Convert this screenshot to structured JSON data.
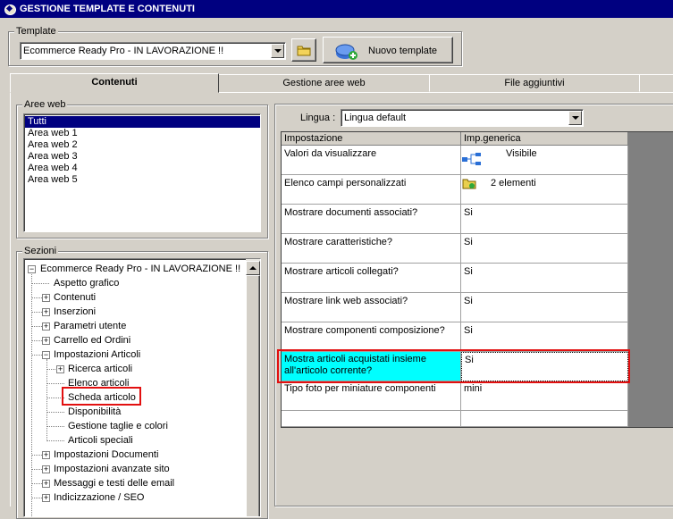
{
  "window": {
    "title": "GESTIONE TEMPLATE E CONTENUTI"
  },
  "template": {
    "group_label": "Template",
    "selected": "Ecommerce Ready Pro - IN LAVORAZIONE !!",
    "new_button": "Nuovo template"
  },
  "tabs": [
    "Contenuti",
    "Gestione aree web",
    "File aggiuntivi"
  ],
  "aree_web": {
    "label": "Aree web",
    "items": [
      "Tutti",
      "Area web 1",
      "Area web 2",
      "Area web 3",
      "Area web 4",
      "Area web 5"
    ]
  },
  "sezioni": {
    "label": "Sezioni",
    "tree": [
      "Ecommerce Ready Pro - IN LAVORAZIONE !!",
      "Aspetto grafico",
      "Contenuti",
      "Inserzioni",
      "Parametri utente",
      "Carrello ed Ordini",
      "Impostazioni Articoli",
      "Ricerca articoli",
      "Elenco articoli",
      "Scheda articolo",
      "Disponibilità",
      "Gestione taglie e colori",
      "Articoli speciali",
      "Impostazioni Documenti",
      "Impostazioni avanzate sito",
      "Messaggi e testi delle email",
      "Indicizzazione / SEO"
    ]
  },
  "lingua": {
    "label": "Lingua :",
    "selected": "Lingua default"
  },
  "grid": {
    "headers": [
      "Impostazione",
      "Imp.generica"
    ],
    "rows": [
      {
        "setting": "Valori da visualizzare",
        "value": "Visibile"
      },
      {
        "setting": "Elenco campi personalizzati",
        "value": "2 elementi"
      },
      {
        "setting": "Mostrare documenti associati?",
        "value": "Si"
      },
      {
        "setting": "Mostrare caratteristiche?",
        "value": "Si"
      },
      {
        "setting": "Mostrare articoli collegati?",
        "value": "Si"
      },
      {
        "setting": "Mostrare link web associati?",
        "value": "Si"
      },
      {
        "setting": "Mostrare componenti composizione?",
        "value": "Si"
      },
      {
        "setting": "Mostra articoli acquistati insieme all'articolo corrente?",
        "value": "Si"
      },
      {
        "setting": "Tipo foto per miniature componenti",
        "value": "mini"
      }
    ]
  },
  "colors": {
    "highlight_row": "#00ffff",
    "annotation_box": "#e21010",
    "selection": "#000080"
  }
}
